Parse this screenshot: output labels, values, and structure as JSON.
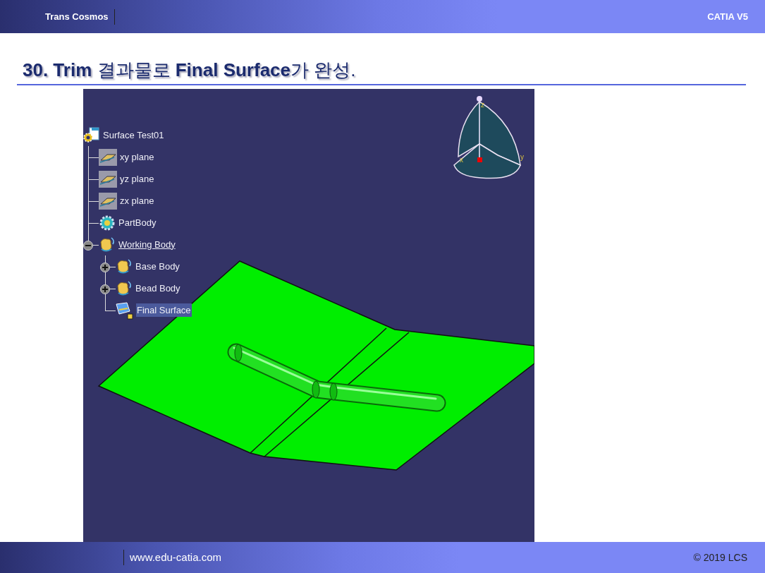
{
  "header": {
    "company": "Trans Cosmos",
    "product": "CATIA V5"
  },
  "title": "**30. Trim** 결과물로 **Final Surface**가 완성.",
  "tree": {
    "label": "Surface Test01",
    "kind": "part",
    "current": false,
    "selected": false,
    "children": [
      {
        "label": "xy plane",
        "kind": "plane",
        "current": false,
        "selected": false
      },
      {
        "label": "yz plane",
        "kind": "plane",
        "current": false,
        "selected": false
      },
      {
        "label": "zx plane",
        "kind": "plane",
        "current": false,
        "selected": false
      },
      {
        "label": "PartBody",
        "kind": "partbody",
        "current": false,
        "selected": false
      },
      {
        "label": "Working Body",
        "kind": "body",
        "expanded": true,
        "current": true,
        "selected": false,
        "children": [
          {
            "label": "Base Body",
            "kind": "body",
            "expanded": false,
            "current": false,
            "selected": false
          },
          {
            "label": "Bead Body",
            "kind": "body",
            "expanded": false,
            "current": false,
            "selected": false
          },
          {
            "label": "Final Surface",
            "kind": "surface",
            "current": false,
            "selected": true
          }
        ]
      }
    ]
  },
  "compass": {
    "axes": [
      "z",
      "x",
      "y"
    ]
  },
  "footer": {
    "website": "www.edu-catia.com",
    "copyright": "© 2019 LCS"
  }
}
